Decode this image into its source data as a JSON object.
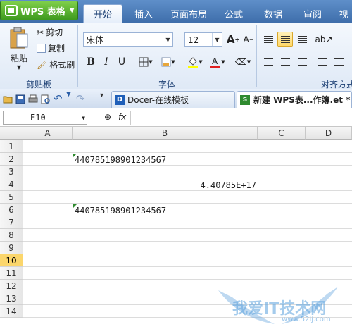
{
  "app": {
    "title": "WPS 表格"
  },
  "tabs": [
    "开始",
    "插入",
    "页面布局",
    "公式",
    "数据",
    "审阅",
    "视"
  ],
  "ribbon": {
    "clipboard": {
      "paste": "粘贴",
      "cut": "剪切",
      "copy": "复制",
      "format_painter": "格式刷",
      "label": "剪贴板"
    },
    "font": {
      "name": "宋体",
      "size": "12",
      "label": "字体",
      "bold": "B",
      "italic": "I",
      "underline": "U",
      "grow": "A",
      "shrink": "A"
    },
    "align": {
      "label": "对齐方式"
    }
  },
  "doctabs": [
    {
      "label": "Docer-在线模板"
    },
    {
      "label": "新建 WPS表...作簿.et *"
    }
  ],
  "formula_bar": {
    "cell_ref": "E10",
    "fx": "fx",
    "value": ""
  },
  "columns": [
    "A",
    "B",
    "C",
    "D"
  ],
  "rows": [
    "1",
    "2",
    "3",
    "4",
    "5",
    "6",
    "7",
    "8",
    "9",
    "10",
    "11",
    "12",
    "13",
    "14"
  ],
  "active_row": "10",
  "cells": {
    "B2": "440785198901234567",
    "B4": "4.40785E+17",
    "B6": "440785198901234567"
  },
  "watermark": {
    "main": "我爱IT技术网",
    "sub": "www.52ij.com"
  },
  "colors": {
    "tab_bar": "#4a7cbb",
    "app_button": "#4fae2a",
    "active_row": "#fbd66c",
    "text_marker": "#2e8b2e"
  }
}
